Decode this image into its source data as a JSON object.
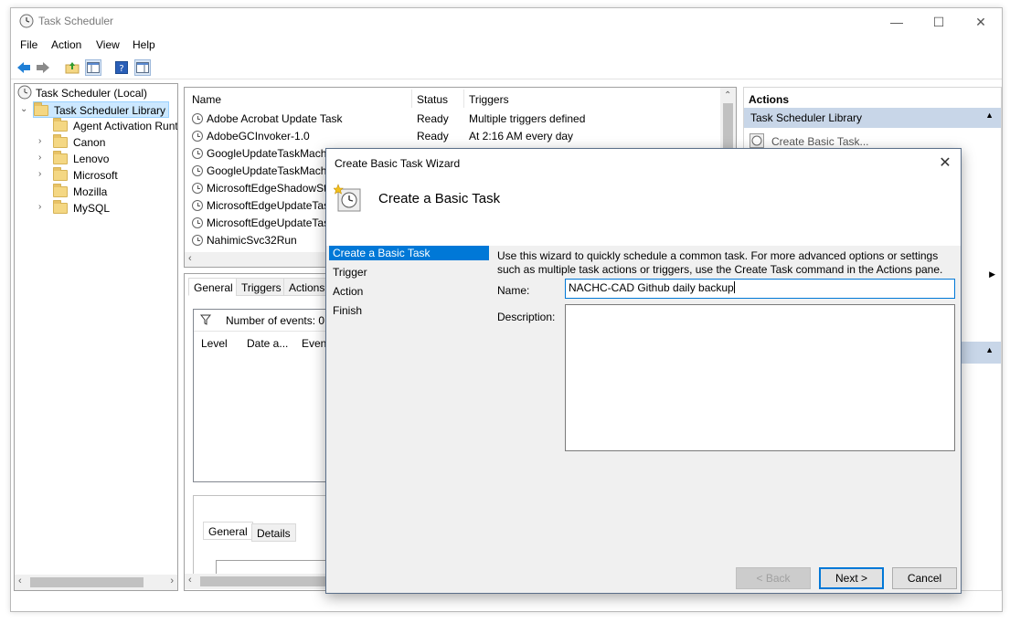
{
  "window": {
    "title": "Task Scheduler"
  },
  "menu": [
    "File",
    "Action",
    "View",
    "Help"
  ],
  "tree": {
    "root": "Task Scheduler (Local)",
    "library": "Task Scheduler Library",
    "children": [
      "Agent Activation Runt",
      "Canon",
      "Lenovo",
      "Microsoft",
      "Mozilla",
      "MySQL"
    ]
  },
  "task_list": {
    "columns": [
      "Name",
      "Status",
      "Triggers"
    ],
    "rows": [
      {
        "name": "Adobe Acrobat Update Task",
        "status": "Ready",
        "triggers": "Multiple triggers defined"
      },
      {
        "name": "AdobeGCInvoker-1.0",
        "status": "Ready",
        "triggers": "At 2:16 AM every day"
      },
      {
        "name": "GoogleUpdateTaskMachi",
        "status": "",
        "triggers": ""
      },
      {
        "name": "GoogleUpdateTaskMachi",
        "status": "",
        "triggers": ""
      },
      {
        "name": "MicrosoftEdgeShadowSta",
        "status": "",
        "triggers": ""
      },
      {
        "name": "MicrosoftEdgeUpdateTas",
        "status": "",
        "triggers": ""
      },
      {
        "name": "MicrosoftEdgeUpdateTas",
        "status": "",
        "triggers": ""
      },
      {
        "name": "NahimicSvc32Run",
        "status": "",
        "triggers": ""
      }
    ]
  },
  "detail_tabs": [
    "General",
    "Triggers",
    "Actions"
  ],
  "history": {
    "events_label": "Number of events: 0",
    "columns": [
      "Level",
      "Date a...",
      "Event"
    ]
  },
  "lower_tabs": [
    "General",
    "Details"
  ],
  "actions_panel": {
    "header": "Actions",
    "section": "Task Scheduler Library",
    "first_item": "Create Basic Task..."
  },
  "dialog": {
    "title": "Create Basic Task Wizard",
    "heading": "Create a Basic Task",
    "steps": [
      "Create a Basic Task",
      "Trigger",
      "Action",
      "Finish"
    ],
    "description_line1": "Use this wizard to quickly schedule a common task.  For more advanced options or settings",
    "description_line2": "such as multiple task actions or triggers, use the Create Task command in the Actions pane.",
    "name_label": "Name:",
    "name_value": "NACHC-CAD Github daily backup",
    "desc_label": "Description:",
    "desc_value": "",
    "buttons": {
      "back": "< Back",
      "next": "Next >",
      "cancel": "Cancel"
    }
  },
  "colors": {
    "selection": "#0078d7",
    "section_band": "#c8d6e8"
  }
}
